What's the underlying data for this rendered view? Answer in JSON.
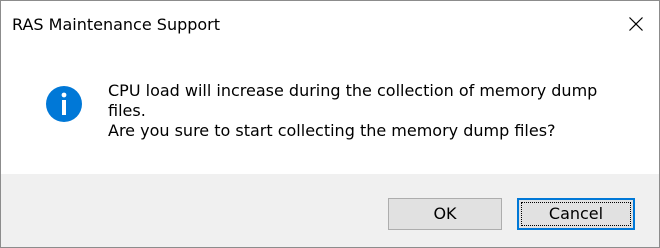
{
  "window": {
    "title": "RAS Maintenance Support"
  },
  "message": {
    "lines": [
      "CPU load will increase during the collection of memory dump",
      "files.",
      "Are you sure to start collecting the memory dump files?"
    ]
  },
  "buttons": {
    "ok_label": "OK",
    "cancel_label": "Cancel"
  },
  "icons": {
    "message_icon": "info-icon",
    "close": "close-icon"
  },
  "colors": {
    "info_icon": "#0078d7",
    "focus_border": "#0078d7",
    "footer_bg": "#f0f0f0"
  }
}
